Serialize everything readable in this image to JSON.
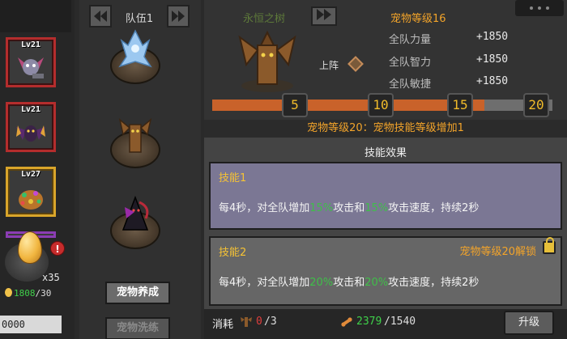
{
  "left_panel": {
    "pets": [
      {
        "level": "Lv21",
        "frame": "red",
        "icon": "bat-robot-icon"
      },
      {
        "level": "Lv21",
        "frame": "red",
        "icon": "dark-bat-icon"
      },
      {
        "level": "Lv27",
        "frame": "gold",
        "icon": "treasure-golem-icon"
      }
    ],
    "egg": {
      "count": "x35",
      "alert": "!",
      "progress_current": "1808",
      "progress_total": "/30"
    },
    "bottom_value": "0000"
  },
  "team": {
    "label": "队伍1",
    "slots": [
      {
        "icon": "ice-spirit-icon"
      },
      {
        "icon": "tree-ent-icon"
      },
      {
        "icon": "shadow-reaper-icon"
      }
    ],
    "train_button": "宠物养成",
    "wash_button": "宠物洗练"
  },
  "pet_detail": {
    "name": "永恒之树",
    "deploy_label": "上阵",
    "level_text": "宠物等级16",
    "stats": [
      {
        "label": "全队力量",
        "value": "+1850"
      },
      {
        "label": "全队智力",
        "value": "+1850"
      },
      {
        "label": "全队敏捷",
        "value": "+1850"
      }
    ],
    "level_track": {
      "milestones": [
        "5",
        "10",
        "15",
        "20"
      ],
      "progress_fraction": 0.8
    },
    "bonus_line": "宠物等级20：宠物技能等级增加1"
  },
  "skills": {
    "title": "技能效果",
    "items": [
      {
        "name": "技能1",
        "prefix": "每4秒，对全队增加",
        "num1": "15%",
        "mid": "攻击和",
        "num2": "15%",
        "suffix": "攻击速度，持续2秒",
        "lock_text": ""
      },
      {
        "name": "技能2",
        "prefix": "每4秒，对全队增加",
        "num1": "20%",
        "mid": "攻击和",
        "num2": "20%",
        "suffix": "攻击速度，持续2秒",
        "lock_text": "宠物等级20解锁"
      }
    ]
  },
  "cost": {
    "label": "消耗",
    "item_current": "0",
    "item_total": "/3",
    "bone_current": "2379",
    "bone_total": "/1540",
    "upgrade_button": "升级"
  },
  "colors": {
    "accent": "#f3a42a",
    "green": "#3fd04a",
    "red": "#e13d3d"
  }
}
